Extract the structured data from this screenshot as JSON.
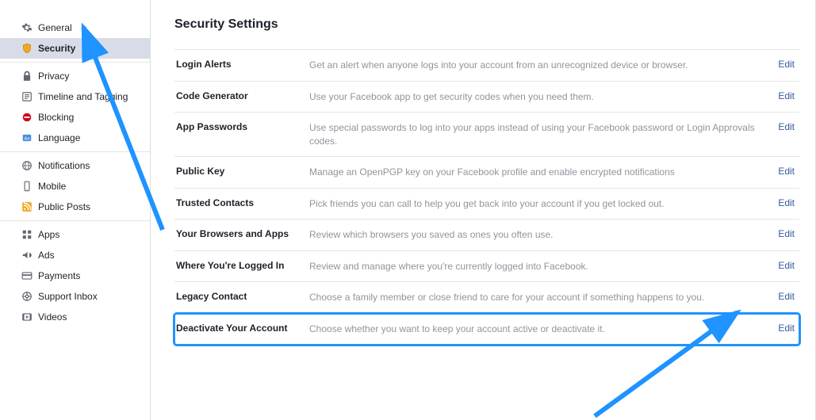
{
  "page": {
    "title": "Security Settings"
  },
  "sidebar": {
    "groups": [
      {
        "items": [
          {
            "icon": "gear-icon",
            "label": "General"
          },
          {
            "icon": "shield-icon",
            "label": "Security",
            "active": true
          }
        ]
      },
      {
        "items": [
          {
            "icon": "lock-icon",
            "label": "Privacy"
          },
          {
            "icon": "timeline-icon",
            "label": "Timeline and Tagging"
          },
          {
            "icon": "block-icon",
            "label": "Blocking"
          },
          {
            "icon": "language-icon",
            "label": "Language"
          }
        ]
      },
      {
        "items": [
          {
            "icon": "globe-icon",
            "label": "Notifications"
          },
          {
            "icon": "mobile-icon",
            "label": "Mobile"
          },
          {
            "icon": "rss-icon",
            "label": "Public Posts"
          }
        ]
      },
      {
        "items": [
          {
            "icon": "apps-icon",
            "label": "Apps"
          },
          {
            "icon": "ads-icon",
            "label": "Ads"
          },
          {
            "icon": "payments-icon",
            "label": "Payments"
          },
          {
            "icon": "support-icon",
            "label": "Support Inbox"
          },
          {
            "icon": "videos-icon",
            "label": "Videos"
          }
        ]
      }
    ]
  },
  "settings": {
    "rows": [
      {
        "title": "Login Alerts",
        "desc": "Get an alert when anyone logs into your account from an unrecognized device or browser.",
        "action": "Edit"
      },
      {
        "title": "Code Generator",
        "desc": "Use your Facebook app to get security codes when you need them.",
        "action": "Edit"
      },
      {
        "title": "App Passwords",
        "desc": "Use special passwords to log into your apps instead of using your Facebook password or Login Approvals codes.",
        "action": "Edit"
      },
      {
        "title": "Public Key",
        "desc": "Manage an OpenPGP key on your Facebook profile and enable encrypted notifications",
        "action": "Edit"
      },
      {
        "title": "Trusted Contacts",
        "desc": "Pick friends you can call to help you get back into your account if you get locked out.",
        "action": "Edit"
      },
      {
        "title": "Your Browsers and Apps",
        "desc": "Review which browsers you saved as ones you often use.",
        "action": "Edit"
      },
      {
        "title": "Where You're Logged In",
        "desc": "Review and manage where you're currently logged into Facebook.",
        "action": "Edit"
      },
      {
        "title": "Legacy Contact",
        "desc": "Choose a family member or close friend to care for your account if something happens to you.",
        "action": "Edit"
      },
      {
        "title": "Deactivate Your Account",
        "desc": "Choose whether you want to keep your account active or deactivate it.",
        "action": "Edit",
        "highlight": true
      }
    ]
  },
  "colors": {
    "link": "#365899",
    "muted": "#90949c",
    "highlight": "#1f93ff",
    "arrow": "#1f93ff"
  }
}
